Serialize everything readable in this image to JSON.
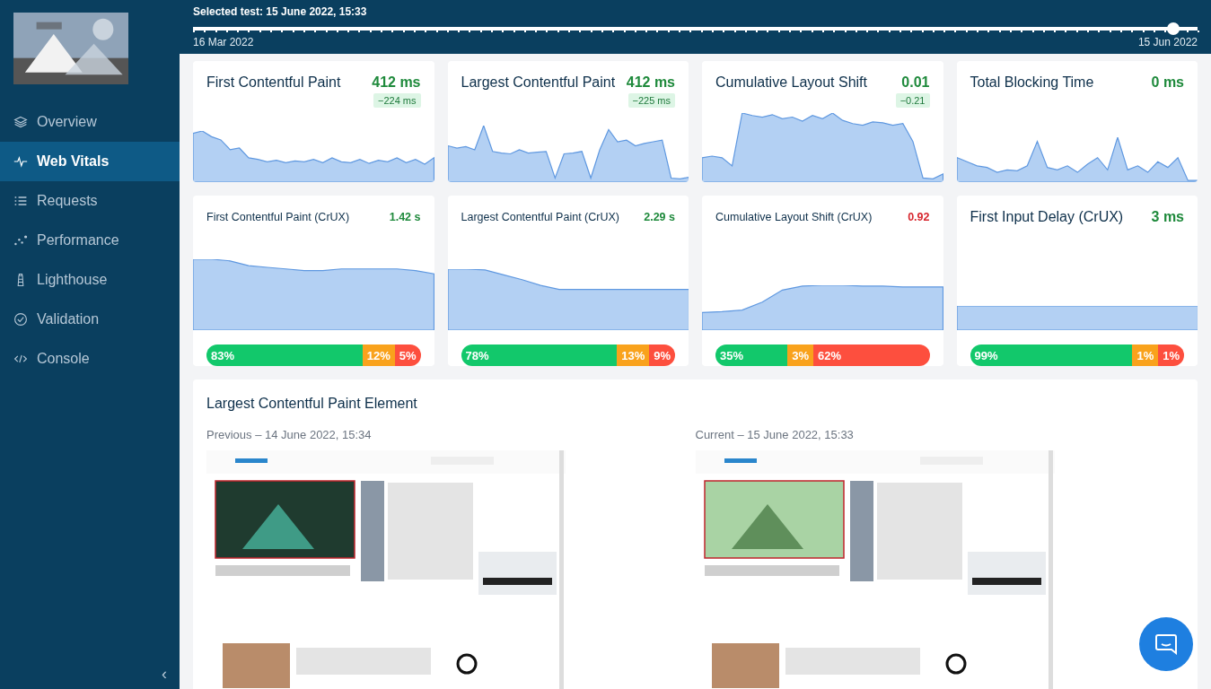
{
  "sidebar": {
    "items": [
      {
        "label": "Overview",
        "selected": false
      },
      {
        "label": "Web Vitals",
        "selected": true
      },
      {
        "label": "Requests",
        "selected": false
      },
      {
        "label": "Performance",
        "selected": false
      },
      {
        "label": "Lighthouse",
        "selected": false
      },
      {
        "label": "Validation",
        "selected": false
      },
      {
        "label": "Console",
        "selected": false
      }
    ],
    "collapse": "‹"
  },
  "header": {
    "selected_test": "Selected test: 15 June 2022, 15:33",
    "start": "16 Mar 2022",
    "end": "15 Jun 2022",
    "level": 0.976
  },
  "metrics": [
    {
      "kind": "lab",
      "title": "First Contentful Paint",
      "value": "412 ms",
      "color": "#1f8a3c",
      "delta": "−224 ms"
    },
    {
      "kind": "lab",
      "title": "Largest Contentful Paint",
      "value": "412 ms",
      "color": "#1f8a3c",
      "delta": "−225 ms"
    },
    {
      "kind": "lab",
      "title": "Cumulative Layout Shift",
      "value": "0.01",
      "color": "#1f8a3c",
      "delta": "−0.21"
    },
    {
      "kind": "lab",
      "title": "Total Blocking Time",
      "value": "0 ms",
      "color": "#1f8a3c"
    },
    {
      "kind": "crux",
      "title": "First Contentful Paint (CrUX)",
      "value": "1.42 s",
      "color": "#1f8a3c",
      "compact": true,
      "distribution": [
        {
          "label": "83%",
          "kind": "good",
          "wide": false
        },
        {
          "label": "12%",
          "kind": "average",
          "wide": false
        },
        {
          "label": "5%",
          "kind": "poor",
          "wide": false
        }
      ]
    },
    {
      "kind": "crux",
      "title": "Largest Contentful Paint (CrUX)",
      "value": "2.29 s",
      "color": "#1f8a3c",
      "compact": true,
      "distribution": [
        {
          "label": "78%",
          "kind": "good",
          "wide": false
        },
        {
          "label": "13%",
          "kind": "average",
          "wide": false
        },
        {
          "label": "9%",
          "kind": "poor",
          "wide": false
        }
      ]
    },
    {
      "kind": "crux",
      "title": "Cumulative Layout Shift (CrUX)",
      "value": "0.92",
      "color": "#d7262e",
      "compact": true,
      "distribution": [
        {
          "label": "35%",
          "kind": "good",
          "wide": false
        },
        {
          "label": "3%",
          "kind": "average",
          "wide": false
        },
        {
          "label": "62%",
          "kind": "poor",
          "wide": true
        }
      ]
    },
    {
      "kind": "crux",
      "title": "First Input Delay (CrUX)",
      "value": "3 ms",
      "color": "#1f8a3c",
      "compact": false,
      "distribution": [
        {
          "label": "99%",
          "kind": "good",
          "wide": false
        },
        {
          "label": "1%",
          "kind": "average",
          "wide": false
        },
        {
          "label": "1%",
          "kind": "poor",
          "wide": false
        }
      ]
    }
  ],
  "lcp": {
    "title": "Largest Contentful Paint Element",
    "shots": [
      {
        "label": "Previous – 14 June 2022, 15:34",
        "kind": "picture"
      },
      {
        "label": "Current – 15 June 2022, 15:33",
        "kind": "picture"
      }
    ]
  }
}
